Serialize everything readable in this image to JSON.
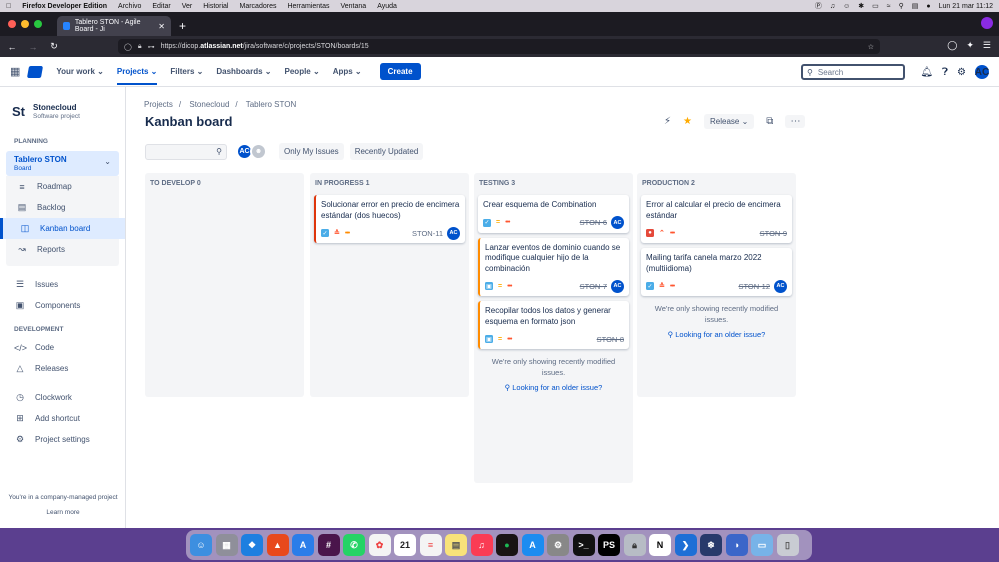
{
  "macos_menu": {
    "apple_icon": "apple-icon",
    "app": "Firefox Developer Edition",
    "items": [
      "Archivo",
      "Editar",
      "Ver",
      "Historial",
      "Marcadores",
      "Herramientas",
      "Ventana",
      "Ayuda"
    ],
    "clock": "Lun 21 mar  11:12"
  },
  "browser": {
    "tab_title": "Tablero STON - Agile Board - Ji",
    "url_prefix": "https://dicop.",
    "url_domain": "atlassian.net",
    "url_path": "/jira/software/c/projects/STON/boards/15"
  },
  "header": {
    "menus": [
      "Your work",
      "Projects",
      "Filters",
      "Dashboards",
      "People",
      "Apps"
    ],
    "active_menu": "Projects",
    "create": "Create",
    "search_placeholder": "Search",
    "user_initials": "AC"
  },
  "sidebar": {
    "project_icon": "St",
    "project_name": "Stonecloud",
    "project_type": "Software project",
    "planning_label": "PLANNING",
    "board_name": "Tablero STON",
    "board_type": "Board",
    "planning_items": [
      {
        "label": "Roadmap",
        "icon": "roadmap-icon"
      },
      {
        "label": "Backlog",
        "icon": "backlog-icon"
      },
      {
        "label": "Kanban board",
        "icon": "board-icon"
      },
      {
        "label": "Reports",
        "icon": "reports-icon"
      }
    ],
    "other_items": [
      {
        "label": "Issues",
        "icon": "issues-icon"
      },
      {
        "label": "Components",
        "icon": "components-icon"
      }
    ],
    "development_label": "DEVELOPMENT",
    "dev_items": [
      {
        "label": "Code",
        "icon": "code-icon"
      },
      {
        "label": "Releases",
        "icon": "releases-icon"
      }
    ],
    "extra_items": [
      {
        "label": "Clockwork",
        "icon": "clock-icon"
      },
      {
        "label": "Add shortcut",
        "icon": "shortcut-icon"
      },
      {
        "label": "Project settings",
        "icon": "settings-icon"
      }
    ],
    "footer_text": "You're in a company-managed project",
    "footer_link": "Learn more"
  },
  "board": {
    "breadcrumb": [
      "Projects",
      "Stonecloud",
      "Tablero STON"
    ],
    "title": "Kanban board",
    "release": "Release",
    "filter_avatar": "AC",
    "quick_filters": [
      "Only My Issues",
      "Recently Updated"
    ],
    "columns": [
      {
        "name": "TO DEVELOP",
        "count": "0",
        "cards": [],
        "note": "",
        "link": ""
      },
      {
        "name": "IN PROGRESS",
        "count": "1",
        "note": "",
        "link": "",
        "cards": [
          {
            "title": "Solucionar error en precio de encimera estándar (dos huecos)",
            "type": "task",
            "priority": "highest",
            "key": "STON-11",
            "done": false,
            "assignee": "AC",
            "flag": "red"
          }
        ]
      },
      {
        "name": "TESTING",
        "count": "3",
        "note": "We're only showing recently modified issues.",
        "link": "Looking for an older issue?",
        "cards": [
          {
            "title": "Crear esquema de Combination",
            "type": "task",
            "priority": "medium",
            "key": "STON-6",
            "done": true,
            "assignee": "AC",
            "flag": ""
          },
          {
            "title": "Lanzar eventos de dominio cuando se modifique cualquier hijo de la combinación",
            "type": "story",
            "priority": "medium",
            "key": "STON-7",
            "done": true,
            "assignee": "AC",
            "flag": "orange"
          },
          {
            "title": "Recopilar todos los datos y generar esquema en formato json",
            "type": "story",
            "priority": "medium",
            "key": "STON-8",
            "done": true,
            "assignee": "",
            "flag": "orange"
          }
        ]
      },
      {
        "name": "PRODUCTION",
        "count": "2",
        "note": "We're only showing recently modified issues.",
        "link": "Looking for an older issue?",
        "cards": [
          {
            "title": "Error al calcular el precio de encimera estándar",
            "type": "bug",
            "priority": "high",
            "key": "STON-9",
            "done": true,
            "assignee": "",
            "flag": ""
          },
          {
            "title": "Mailing tarifa canela marzo 2022 (multiidioma)",
            "type": "task",
            "priority": "highest",
            "key": "STON-12",
            "done": true,
            "assignee": "AC",
            "flag": ""
          }
        ]
      }
    ]
  },
  "dock": {
    "calendar_day": "21"
  },
  "colors": {
    "primary": "#0052cc",
    "task": "#4bade8",
    "story": "#65ba43",
    "bug": "#e5493a",
    "priority_high": "#ff5630",
    "priority_medium": "#ffab00"
  }
}
